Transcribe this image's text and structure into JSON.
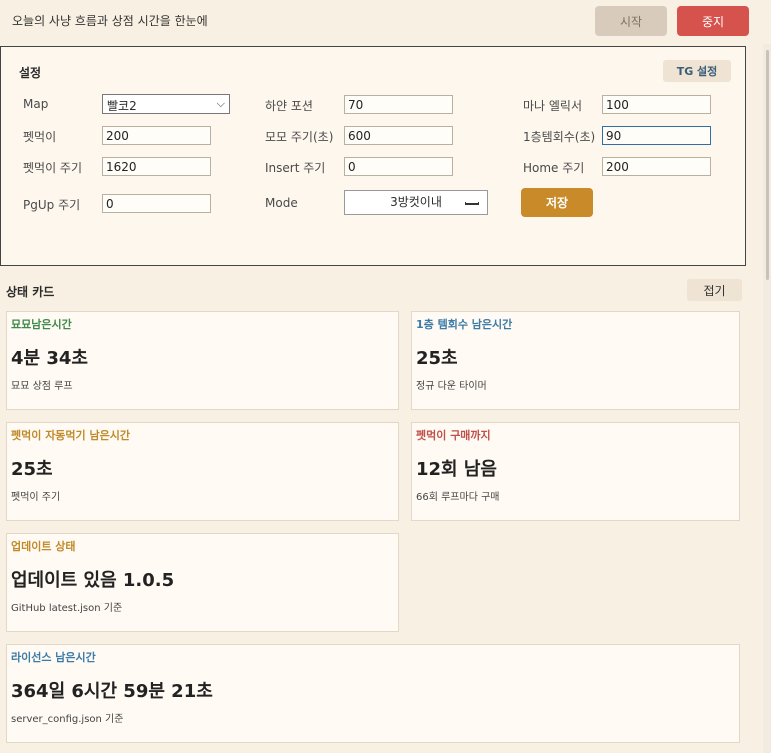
{
  "header": {
    "subtitle": "오늘의 사냥 흐름과 상점 시간을 한눈에",
    "start_label": "시작",
    "stop_label": "중지"
  },
  "settings": {
    "title": "설정",
    "tg_button": "TG 설정",
    "fields": {
      "map": {
        "label": "Map",
        "value": "빨코2"
      },
      "white_potion": {
        "label": "하얀 포션",
        "value": "70"
      },
      "mana_elixir": {
        "label": "마나 엘릭서",
        "value": "100"
      },
      "pet_food": {
        "label": "펫먹이",
        "value": "200"
      },
      "momo_cycle": {
        "label": "모모 주기(초)",
        "value": "600"
      },
      "floor1_temple": {
        "label": "1층템회수(초)",
        "value": "90"
      },
      "pet_food_cycle": {
        "label": "펫먹이 주기",
        "value": "1620"
      },
      "insert_cycle": {
        "label": "Insert 주기",
        "value": "0"
      },
      "home_cycle": {
        "label": "Home 주기",
        "value": "200"
      },
      "pgup_cycle": {
        "label": "PgUp 주기",
        "value": "0"
      },
      "mode": {
        "label": "Mode",
        "value": "3방컷이내"
      }
    },
    "save_label": "저장"
  },
  "status": {
    "title": "상태 카드",
    "fold_label": "접기",
    "cards": [
      {
        "title": "묘묘남은시간",
        "value": "4분 34초",
        "sub": "묘묘 상점 루프",
        "color": "#3e8a4a"
      },
      {
        "title": "1층 템회수 남은시간",
        "value": "25초",
        "sub": "정규 다운 타이머",
        "color": "#3a7ba8"
      },
      {
        "title": "펫먹이 자동먹기 남은시간",
        "value": "25초",
        "sub": "펫먹이 주기",
        "color": "#c08a2a"
      },
      {
        "title": "펫먹이 구매까지",
        "value": "12회 남음",
        "sub": "66회 루프마다 구매",
        "color": "#c0504a"
      },
      {
        "title": "업데이트 상태",
        "value": "업데이트 있음 1.0.5",
        "sub": "GitHub latest.json 기준",
        "color": "#c08a2a"
      },
      {
        "title": "라이선스 남은시간",
        "value": "364일 6시간 59분 21초",
        "sub": "server_config.json 기준",
        "color": "#3a7ba8"
      }
    ]
  }
}
